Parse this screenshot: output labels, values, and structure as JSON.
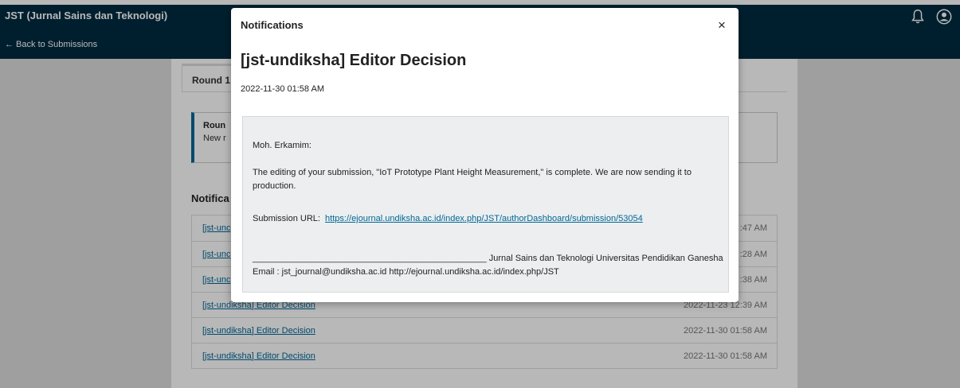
{
  "header": {
    "app_title": "JST (Jurnal Sains dan Teknologi)",
    "back_link": "← Back to Submissions",
    "icons": [
      "bell-icon",
      "user-icon"
    ]
  },
  "workflow": {
    "round_tab": "Round 1",
    "round_box_title": "Roun",
    "round_box_text": "New r",
    "notifications_heading": "Notifica",
    "rows": [
      {
        "subject": "[jst-unc",
        "date": ":47 AM"
      },
      {
        "subject": "[jst-unc",
        "date": ":28 AM"
      },
      {
        "subject": "[jst-unc",
        "date": ":38 AM"
      },
      {
        "subject": "[jst-undiksha] Editor Decision",
        "date": "2022-11-23 12:39 AM"
      },
      {
        "subject": "[jst-undiksha] Editor Decision",
        "date": "2022-11-30 01:58 AM"
      },
      {
        "subject": "[jst-undiksha] Editor Decision",
        "date": "2022-11-30 01:58 AM"
      }
    ]
  },
  "modal": {
    "header": "Notifications",
    "close_label": "×",
    "title": "[jst-undiksha] Editor Decision",
    "date": "2022-11-30 01:58 AM",
    "greeting": "Moh. Erkamim:",
    "body": "The editing of your submission, \"IoT Prototype Plant Height Measurement,\" is complete. We are now sending it to production.",
    "url_label": "Submission URL:",
    "url": "https://ejournal.undiksha.ac.id/index.php/JST/authorDashboard/submission/53054",
    "signature": "________________________________________________ Jurnal Sains dan Teknologi Universitas Pendidikan Ganesha Email : jst_journal@undiksha.ac.id http://ejournal.undiksha.ac.id/index.php/JST"
  },
  "colors": {
    "header_bg": "#002c41",
    "link": "#006798",
    "email_bg": "#eceeef"
  }
}
